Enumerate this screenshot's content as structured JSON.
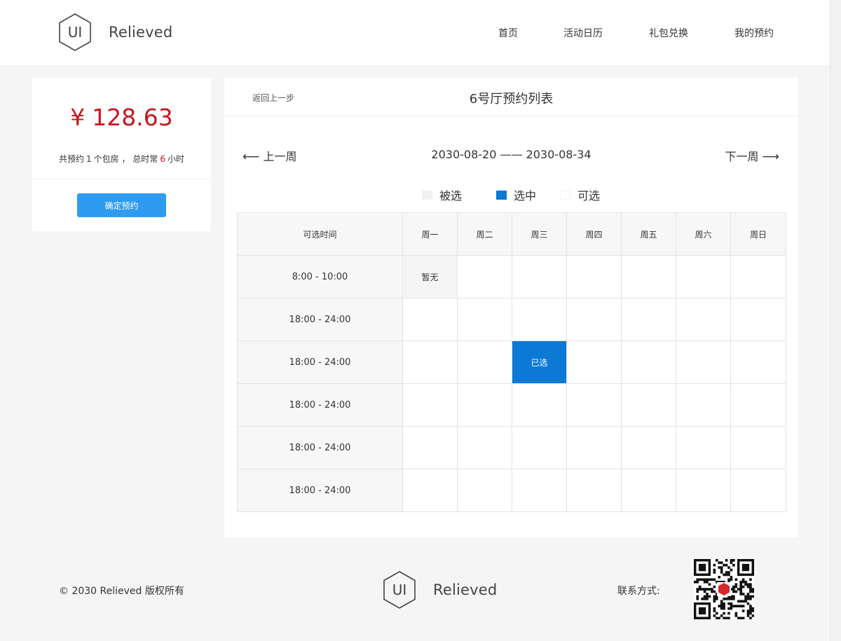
{
  "brand": {
    "logo_mark": "UI",
    "name": "Relieved"
  },
  "nav": {
    "items": [
      "首页",
      "活动日历",
      "礼包兑换",
      "我的预约"
    ]
  },
  "summary": {
    "currency": "¥",
    "amount": "128.63",
    "desc_prefix": "共预约",
    "room_count": "1",
    "desc_mid": "个包房 ， 总时常",
    "hours": "6",
    "desc_suffix": "小时",
    "confirm_label": "确定预约"
  },
  "panel": {
    "back_label": "返回上一步",
    "title": "6号厅预约列表",
    "prev_week": "上一周",
    "next_week": "下一周",
    "date_range": "2030-08-20 —— 2030-08-34",
    "legend": [
      {
        "label": "被选",
        "color": "#f1f1f1"
      },
      {
        "label": "选中",
        "color": "#0c79d4"
      },
      {
        "label": "可选",
        "color": "#ffffff"
      }
    ]
  },
  "schedule": {
    "time_header": "可选时间",
    "days": [
      "周一",
      "周二",
      "周三",
      "周四",
      "周五",
      "周六",
      "周日"
    ],
    "rows": [
      {
        "time": "8:00 - 10:00",
        "cells": [
          "暂无",
          "",
          "",
          "",
          "",
          "",
          ""
        ],
        "states": [
          "booked",
          "",
          "",
          "",
          "",
          "",
          ""
        ]
      },
      {
        "time": "18:00 - 24:00",
        "cells": [
          "",
          "",
          "",
          "",
          "",
          "",
          ""
        ],
        "states": [
          "",
          "",
          "",
          "",
          "",
          "",
          ""
        ]
      },
      {
        "time": "18:00 - 24:00",
        "cells": [
          "",
          "",
          "已选",
          "",
          "",
          "",
          ""
        ],
        "states": [
          "",
          "",
          "selected",
          "",
          "",
          "",
          ""
        ]
      },
      {
        "time": "18:00 - 24:00",
        "cells": [
          "",
          "",
          "",
          "",
          "",
          "",
          ""
        ],
        "states": [
          "",
          "",
          "",
          "",
          "",
          "",
          ""
        ]
      },
      {
        "time": "18:00 - 24:00",
        "cells": [
          "",
          "",
          "",
          "",
          "",
          "",
          ""
        ],
        "states": [
          "",
          "",
          "",
          "",
          "",
          "",
          ""
        ]
      },
      {
        "time": "18:00 - 24:00",
        "cells": [
          "",
          "",
          "",
          "",
          "",
          "",
          ""
        ],
        "states": [
          "",
          "",
          "",
          "",
          "",
          "",
          ""
        ]
      }
    ]
  },
  "footer": {
    "copyright": "© 2030 Relieved 版权所有",
    "contact_label": "联系方式:",
    "qr_icon": "qr-code-icon"
  },
  "colors": {
    "accent": "#2f9bf0",
    "selected": "#0c79d4",
    "price": "#c8161d"
  }
}
